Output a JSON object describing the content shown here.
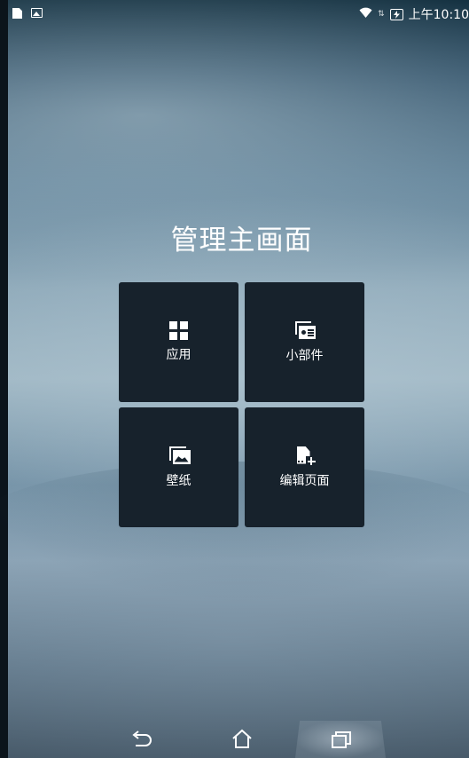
{
  "status_bar": {
    "left_icons": [
      "sd-card-icon",
      "image-notification-icon"
    ],
    "right_icons": [
      "wifi-icon",
      "data-arrows-icon",
      "battery-charging-icon"
    ],
    "time": "上午10:10"
  },
  "dialog": {
    "title": "管理主画面",
    "tiles": [
      {
        "label": "应用",
        "icon": "apps-grid-icon"
      },
      {
        "label": "小部件",
        "icon": "widget-icon"
      },
      {
        "label": "壁纸",
        "icon": "wallpaper-icon"
      },
      {
        "label": "编辑页面",
        "icon": "edit-page-icon"
      }
    ]
  },
  "nav_bar": {
    "buttons": [
      "back-icon",
      "home-icon",
      "recent-apps-icon"
    ]
  },
  "colors": {
    "tile_background": "#17222c",
    "text": "#ffffff"
  }
}
